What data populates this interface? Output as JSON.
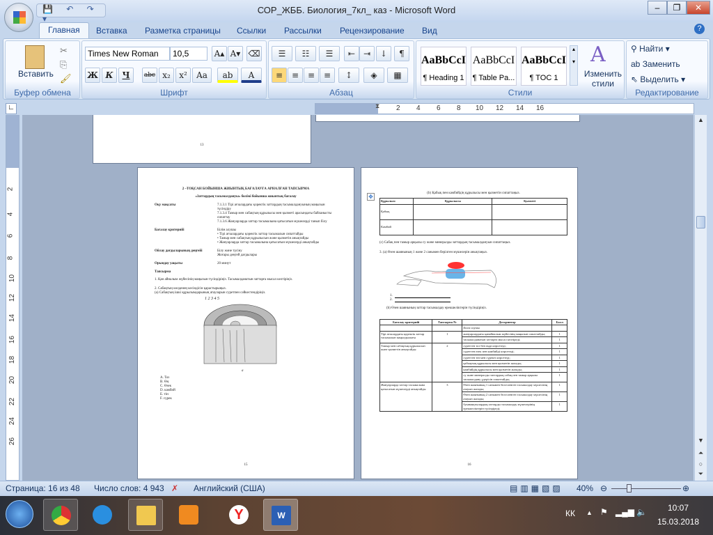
{
  "window": {
    "title": "СОР_ЖББ. Биология_7кл_ каз - Microsoft Word",
    "minimize": "–",
    "restore": "❐",
    "close": "✕"
  },
  "qat": {
    "items": "💾 ↶ ↷ ▾"
  },
  "tabs": [
    "Главная",
    "Вставка",
    "Разметка страницы",
    "Ссылки",
    "Рассылки",
    "Рецензирование",
    "Вид"
  ],
  "help": "?",
  "ribbon": {
    "clipboard": {
      "label": "Буфер обмена",
      "paste": "Вставить"
    },
    "font": {
      "label": "Шрифт",
      "name": "Times New Roman",
      "size": "10,5",
      "bold": "Ж",
      "italic": "К",
      "underline": "Ч",
      "strike": "abc",
      "sub": "x₂",
      "sup": "x²",
      "case": "Aa",
      "grow": "A▴",
      "shrink": "A▾"
    },
    "paragraph": {
      "label": "Абзац",
      "pilcrow": "¶"
    },
    "styles": {
      "label": "Стили",
      "items": [
        {
          "sample": "AaBbCcI",
          "name": "¶ Heading 1"
        },
        {
          "sample": "AaBbCcI",
          "name": "¶ Table Pa..."
        },
        {
          "sample": "AaBbCcI",
          "name": "¶ TOC 1"
        }
      ],
      "change": "Изменить стили"
    },
    "editing": {
      "label": "Редактирование",
      "find": "Найти",
      "replace": "Заменить",
      "select": "Выделить"
    }
  },
  "hruler": [
    "2",
    "4",
    "6",
    "8",
    "10",
    "12",
    "14",
    "16"
  ],
  "vruler": [
    "2",
    "4",
    "6",
    "8",
    "10",
    "12",
    "14",
    "16",
    "18",
    "20",
    "22",
    "24",
    "26"
  ],
  "pages": {
    "top_page_number": "13",
    "left": {
      "heading": "2 –ТОҚСАН БОЙЫНША ЖИЫНТЫҚ БАҒАЛАУҒА АРНАЛҒАН ТАПСЫРМА",
      "subheading": "«Заттардың тасымалдануы» бөлімі бойынша жиынтық бағалау",
      "rows": [
        {
          "k": "Оқу мақсаты",
          "v": [
            "7.1.3.1 Тірі ағзалардағы қоректік заттардың тасымалдануының маңызын түсіндіру",
            "7.1.3.4 Тамыр мен сабақтың құрылысы мен қызметі арасындағы байланысты сипаттау",
            "7.1.3.6 Жануарларда заттар тасымалына қатысатын мүшелерді танып білу"
          ]
        },
        {
          "k": "Бағалау критерийі",
          "v": [
            "Білім алушы",
            "• Тірі ағзалардағы қоректік заттар тасымалын сипаттайды",
            "• Тамыр мен сабақтың құрылысын және қызметін анықтайды",
            "• Жануарларда заттар тасымалына қатысатын мүшелерді анықтайды"
          ]
        },
        {
          "k": "Ойлау дағдыларының деңгейі",
          "v": [
            "Білу және түсіну",
            "Жоғары деңгей дағдылары"
          ]
        },
        {
          "k": "Орындау уақыты",
          "v": [
            "20 минут"
          ]
        }
      ],
      "task_title": "Тапсырма",
      "q1": "1. Қан айналым жүйесінің маңызын түсіндіріңіз. Тасымалданатын заттарға мысал келтіріңіз.",
      "q2": "2. Сабақтың көлденең кесіндісін қарастырыңыз.",
      "q2a": "(a) Сабақтың ішкі құрылымдарының атауларын суретпен сәйкестендіріңіз.",
      "fig_labels": "1  2  3  4  5",
      "fig_caption": "a",
      "options": [
        "A. Тоз",
        "B. Өң",
        "C. Өзек",
        "D. камбий",
        "E. тін",
        "F. сүрек"
      ],
      "page_number": "15"
    },
    "right": {
      "q2b": "(b) Қабық пен камбийдің құрылысы мен қызметін сипаттаңыз.",
      "table_head": [
        "Құрылым",
        "Құрылысы",
        "Қызметі"
      ],
      "table_rows": [
        "Қабық",
        "Камбий"
      ],
      "q2c": "(c) Сабақ пен тамыр арқылы су және минералды заттардың тасымалдануын сипаттаңыз.",
      "q3a": "3. (a) Өзен шаянының 1 және 2 санымен берілген мүшелерін анықтаңыз.",
      "blanks": [
        "1.",
        "2."
      ],
      "q3b": "(b) Өзен шаянының заттар тасымалдау ерекшеліктерін түсіндіріңіз.",
      "crit_head": [
        "Бағалау критерийі",
        "Тапсырма №",
        "Дескриптор",
        "Балл"
      ],
      "crit_sub": "Білім алушы",
      "crit": [
        {
          "c": "Тірі ағзалардағы қоректік заттар тасымалын маңыздылығы",
          "n": "1",
          "d": [
            "жануарлардағы қанайналым жүйесінің маңызын сипаттайды;",
            "тасымалданатын заттарға мысал келтіреді;"
          ]
        },
        {
          "c": "Тамыр мен сабақтың құрылысын және қызметін анықтайды",
          "n": "2",
          "d": [
            "суреттен тоз бен өңді көрсетеді;",
            "суреттен өзек пен камбийді көрсетеді;",
            "суреттен тін мен сүректі көрсетеді;",
            "қабықтың құрылысы мен қызметін жазады;",
            "камбийдің құрылысы мен қызметін жазады;",
            "су және минералды заттардың сабақ пен тамыр арқылы тасымалдану үдерісін сипаттайды;"
          ]
        },
        {
          "c": "Жануарларда заттар тасымалына қатысатын мүшелерді анықтайды",
          "n": "3",
          "d": [
            "Өзен шаянының 1 санымен белгіленген тасымалдау мүшесінің атауын жазады;",
            "Өзен шаянының 2 санымен белгіленген тасымалдау мүшесінің атауын жазады;",
            "буынаяқтылардың заттарды тасымалдау мүшелерінің ерекшеліктерін түсіндіреді;"
          ]
        }
      ],
      "points": "1",
      "page_number": "16"
    }
  },
  "status": {
    "page": "Страница: 16 из 48",
    "words": "Число слов: 4 943",
    "language": "Английский (США)",
    "zoom": "40%",
    "zoom_fraction": 0.25
  },
  "taskbar": {
    "lang": "КК",
    "time": "10:07",
    "date": "15.03.2018"
  }
}
